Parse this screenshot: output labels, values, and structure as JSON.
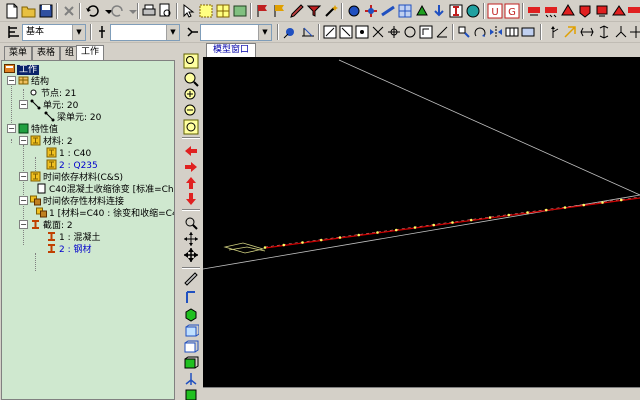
{
  "toolbar": {
    "stage_value": "基本",
    "combo2_value": "",
    "combo3_value": ""
  },
  "left_panel": {
    "tabs": [
      "菜单",
      "表格",
      "组",
      "工作"
    ],
    "tree": {
      "root": "工作",
      "structure": "结构",
      "nodes": "节点: 21",
      "elements": "单元: 20",
      "beam_elements": "梁单元: 20",
      "properties": "特性值",
      "materials": "材料: 2",
      "material_1": "1 : C40",
      "material_2": "2 : Q235",
      "time_dep_material": "时间依存材料(C&S)",
      "time_dep_item": "C40混凝土收缩徐变 [标准=Chi",
      "time_dep_link": "时间依存性材料连接",
      "time_dep_link_item": "1 [材料=C40 : 徐变和收缩=C4",
      "sections": "截面: 2",
      "section_1": "1 : 混凝土",
      "section_2": "2 : 钢材"
    }
  },
  "model_window": {
    "tab_label": "模型窗口"
  },
  "colors": {
    "tree_bg": "#cfe8cf",
    "viewport_bg": "#000000",
    "beam_line": "#cc0000",
    "node_dot": "#ffff66",
    "selected_blue": "#0a246a"
  }
}
